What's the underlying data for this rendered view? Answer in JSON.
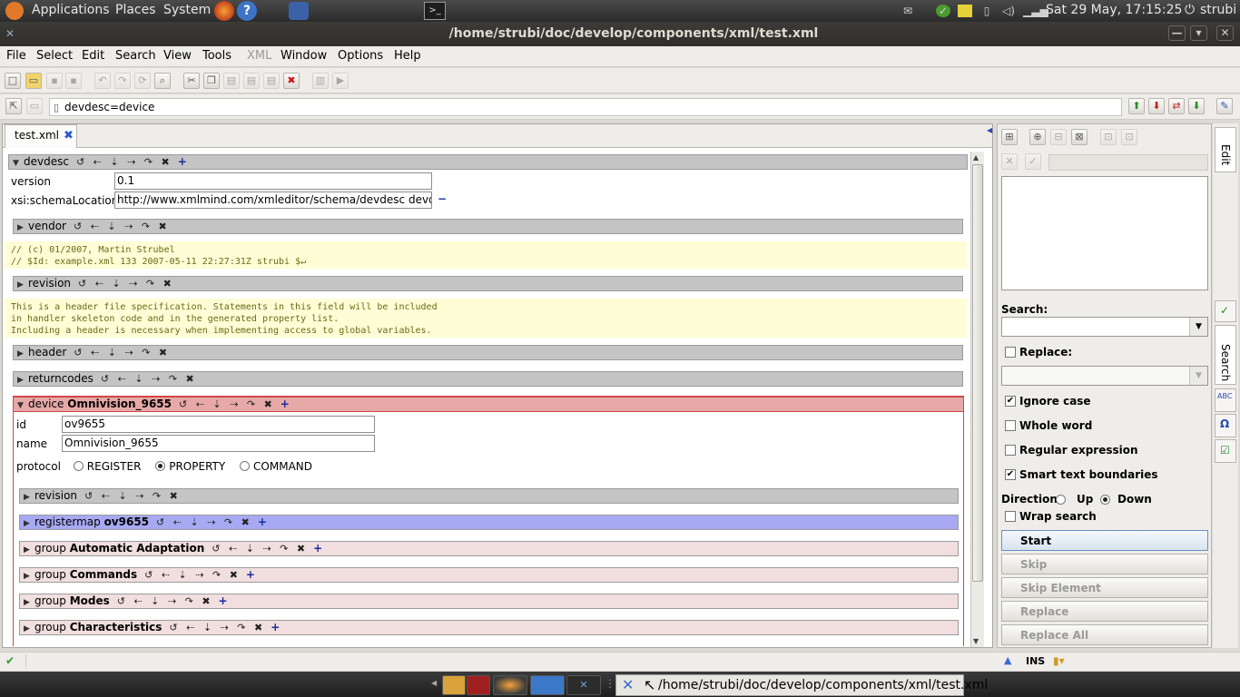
{
  "gnome_panel": {
    "applications": "Applications",
    "places": "Places",
    "system": "System",
    "clock": "Sat 29 May, 17:15:25",
    "user": "strubi"
  },
  "window": {
    "title": "/home/strubi/doc/develop/components/xml/test.xml",
    "min": "—",
    "max": "▾",
    "close": "✕"
  },
  "menu": [
    "File",
    "Select",
    "Edit",
    "Search",
    "View",
    "Tools",
    "XML",
    "Window",
    "Options",
    "Help"
  ],
  "pathbar": {
    "path": "devdesc=device"
  },
  "tab": {
    "name": "test.xml",
    "close": "✖"
  },
  "ops": "↺ ⇠ ⇣ ⇢ ↷ ✖",
  "doc": {
    "devdesc": {
      "tag": "devdesc",
      "version_label": "version",
      "version_value": "0.1",
      "schema_label": "xsi:schemaLocation",
      "schema_value": "http://www.xmlmind.com/xmleditor/schema/devdesc devd",
      "remove": "−"
    },
    "vendor": "vendor",
    "comment1": "// (c) 01/2007, Martin Strubel\n// $Id: example.xml 133 2007-05-11 22:27:31Z strubi $↵",
    "revision": "revision",
    "comment2": "This is a header file specification. Statements in this field will be included\nin handler skeleton code and in the generated property list.\nIncluding a header is necessary when implementing access to global variables.",
    "header": "header",
    "returncodes": "returncodes",
    "device": {
      "tag": "device",
      "name": "Omnivision_9655",
      "id_label": "id",
      "id_value": "ov9655",
      "name_label": "name",
      "name_value": "Omnivision_9655",
      "protocol_label": "protocol",
      "protocol_options": [
        "REGISTER",
        "PROPERTY",
        "COMMAND"
      ],
      "protocol_selected": "PROPERTY"
    },
    "device_revision": "revision",
    "registermap": {
      "tag": "registermap",
      "name": "ov9655"
    },
    "groups": [
      {
        "tag": "group",
        "name": "Automatic Adaptation"
      },
      {
        "tag": "group",
        "name": "Commands"
      },
      {
        "tag": "group",
        "name": "Modes"
      },
      {
        "tag": "group",
        "name": "Characteristics"
      }
    ]
  },
  "search_panel": {
    "search_label": "Search:",
    "replace_label": "Replace:",
    "ignore_case": "Ignore case",
    "whole_word": "Whole word",
    "regex": "Regular expression",
    "smart": "Smart text boundaries",
    "direction_label": "Direction:",
    "up": "Up",
    "down": "Down",
    "wrap": "Wrap search",
    "buttons": [
      "Start",
      "Skip",
      "Skip Element",
      "Replace",
      "Replace All"
    ]
  },
  "side_tabs": [
    "Edit",
    "Search"
  ],
  "status": {
    "mode": "INS"
  },
  "taskbar": {
    "active": "/home/strubi/doc/develop/components/xml/test.xml"
  }
}
